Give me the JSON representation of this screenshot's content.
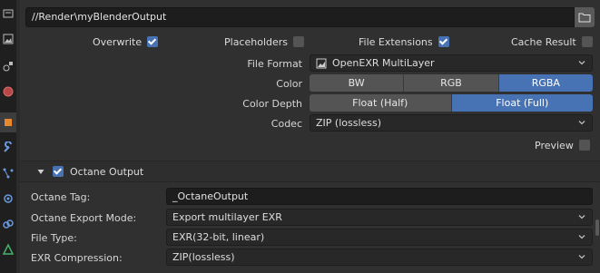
{
  "path": {
    "value": "//Render\\myBlenderOutput"
  },
  "checks": [
    {
      "label": "Overwrite",
      "checked": true
    },
    {
      "label": "Placeholders",
      "checked": false
    },
    {
      "label": "File Extensions",
      "checked": true
    },
    {
      "label": "Cache Result",
      "checked": false
    }
  ],
  "file_format": {
    "label": "File Format",
    "value": "OpenEXR MultiLayer"
  },
  "color": {
    "label": "Color",
    "options": [
      "BW",
      "RGB",
      "RGBA"
    ],
    "selected": "RGBA"
  },
  "color_depth": {
    "label": "Color Depth",
    "options": [
      "Float (Half)",
      "Float (Full)"
    ],
    "selected": "Float (Full)"
  },
  "codec": {
    "label": "Codec",
    "value": "ZIP (lossless)"
  },
  "preview": {
    "label": "Preview",
    "checked": false
  },
  "octane_panel": {
    "title": "Octane Output",
    "enabled": true,
    "expanded": true
  },
  "octane": {
    "tag_label": "Octane Tag:",
    "tag_value": "_OctaneOutput",
    "export_mode_label": "Octane Export Mode:",
    "export_mode_value": "Export multilayer EXR",
    "file_type_label": "File Type:",
    "file_type_value": "EXR(32-bit, linear)",
    "exr_comp_label": "EXR Compression:",
    "exr_comp_value": "ZIP(lossless)"
  },
  "accent": "#4772b3"
}
